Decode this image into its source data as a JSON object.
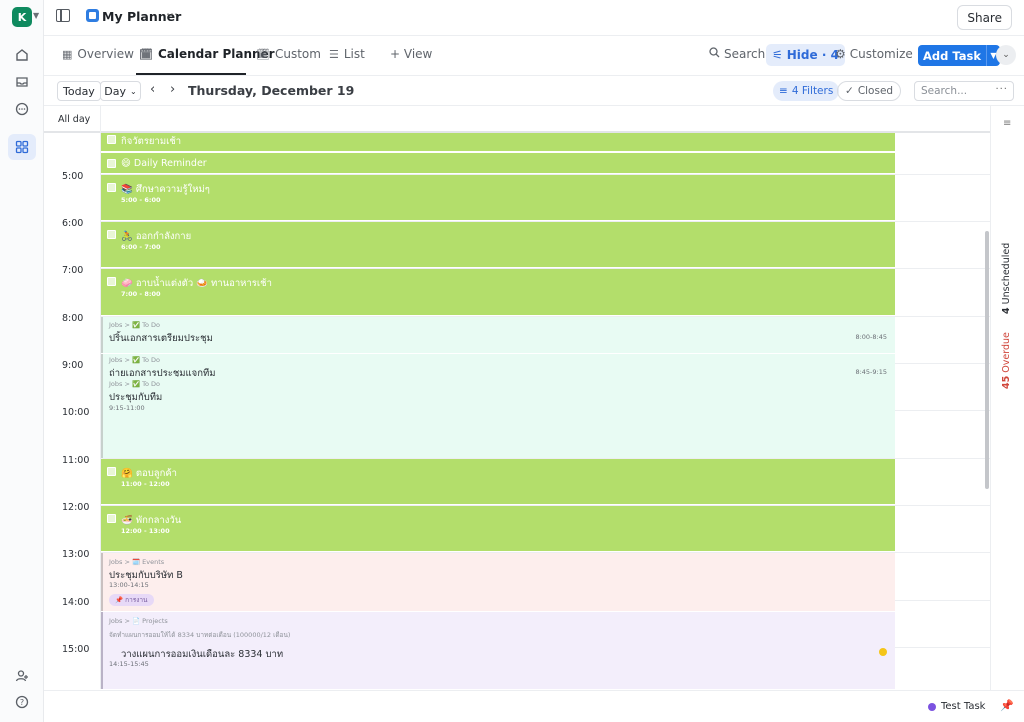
{
  "workspace": {
    "initial": "K"
  },
  "header": {
    "title": "My Planner",
    "more": "⋯",
    "share_label": "Share"
  },
  "tabs": [
    {
      "label": "Overview"
    },
    {
      "label": "Calendar Planner"
    },
    {
      "label": "Custom"
    },
    {
      "label": "List"
    },
    {
      "label": "+ View"
    }
  ],
  "toolbar": {
    "search_label": "Search",
    "hide_label": "Hide · 4",
    "customize_label": "Customize",
    "add_task_label": "Add Task"
  },
  "datebar": {
    "today_label": "Today",
    "day_label": "Day",
    "date": "Thursday, December 19",
    "filters_label": "4 Filters",
    "closed_label": "Closed",
    "search_placeholder": "Search..."
  },
  "allday_label": "All day",
  "hours": [
    "5:00",
    "6:00",
    "7:00",
    "8:00",
    "9:00",
    "10:00",
    "11:00",
    "12:00",
    "13:00",
    "14:00",
    "15:00"
  ],
  "events": {
    "e1": {
      "title": "กิจวัตรยามเช้า"
    },
    "e2": {
      "title": "😄 Daily Reminder"
    },
    "e3": {
      "title": "📚 ศึกษาความรู้ใหม่ๆ",
      "time": "5:00 - 6:00"
    },
    "e4": {
      "title": "🚴 ออกกำลังกาย",
      "time": "6:00 - 7:00"
    },
    "e5": {
      "title": "🧼 อาบน้ำแต่งตัว 🍛 ทานอาหารเช้า",
      "time": "7:00 - 8:00"
    },
    "e6": {
      "crumb": "Jobs > ✅ To Do",
      "title": "ปริ้นเอกสารเตรียมประชุม",
      "time": "8:00-8:45"
    },
    "e7": {
      "crumb": "Jobs > ✅ To Do",
      "title": "ถ่ายเอกสารประชุมแจกทีม",
      "time": "8:45-9:15"
    },
    "e8": {
      "crumb": "Jobs > ✅ To Do",
      "title": "ประชุมกับทีม",
      "time": "9:15-11:00"
    },
    "e9": {
      "title": "🤗 ตอบลูกค้า",
      "time": "11:00 - 12:00"
    },
    "e10": {
      "title": "🍜 พักกลางวัน",
      "time": "12:00 - 13:00"
    },
    "e11": {
      "crumb": "Jobs > 🗓️ Events",
      "title": "ประชุมกับบริษัท B",
      "time": "13:00-14:15",
      "tag": "📌 การงาน"
    },
    "e12": {
      "crumb": "Jobs > 📄 Projects",
      "subcrumb": "จัดทำแผนการออมให้ได้ 8334 บาทต่อเดือน (100000/12 เดือน)",
      "title": "วางแผนการออมเงินเดือนละ 8334 บาท",
      "time": "14:15-15:45"
    }
  },
  "right_panel": {
    "unscheduled_count": "4",
    "unscheduled_label": "Unscheduled",
    "overdue_count": "45",
    "overdue_label": "Overdue"
  },
  "bottom": {
    "test_task_label": "Test Task"
  },
  "colors": {
    "accent": "#1f76e6",
    "event_green": "#b3de6b",
    "event_mint": "#e8fbf3",
    "event_pink": "#fdeeed",
    "event_lavender": "#f3eefb",
    "overdue": "#d0463b"
  }
}
